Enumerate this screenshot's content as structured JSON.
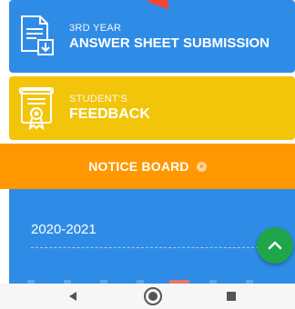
{
  "menu": {
    "answer_sheet": {
      "subtitle": "3RD YEAR",
      "title": "ANSWER SHEET SUBMISSION",
      "icon": "document-download-icon",
      "color": "#2f8ce6"
    },
    "feedback": {
      "subtitle": "STUDENT'S",
      "title": "FEEDBACK",
      "icon": "certificate-icon",
      "color": "#f2c40a"
    },
    "notice_board": {
      "label": "NOTICE BOARD",
      "icon": "arrow-circle-right-icon",
      "color": "#ff9800"
    }
  },
  "notices": {
    "items": [
      {
        "label": "2020-2021"
      }
    ]
  },
  "fab": {
    "icon": "chevron-up-icon",
    "color": "#1fa64a"
  },
  "navbar": {
    "back_icon": "back-triangle-icon",
    "home_icon": "home-circle-icon",
    "recents_icon": "recents-square-icon"
  }
}
